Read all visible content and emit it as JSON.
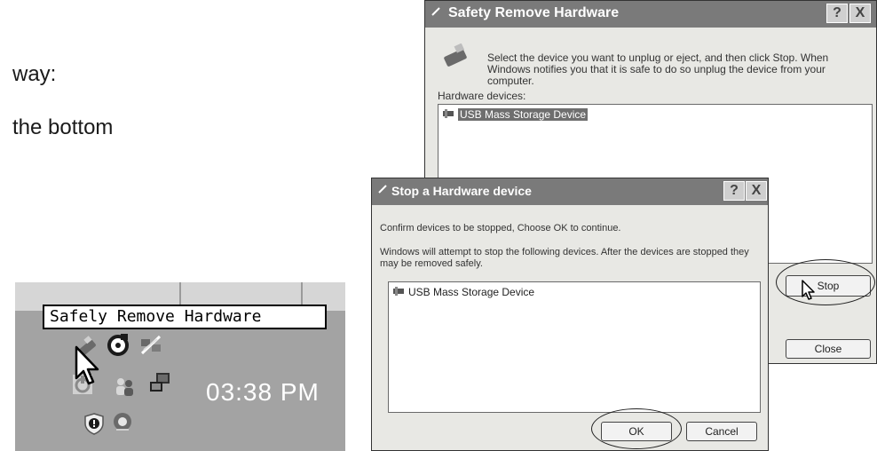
{
  "doc": {
    "line1": "way:",
    "line2": "the bottom"
  },
  "tray": {
    "tooltip": "Safely Remove Hardware",
    "clock": "03:38 PM",
    "icons": [
      "safely-remove-hardware-icon",
      "speaker-icon",
      "network-icon",
      "power-icon",
      "users-icon",
      "computer-icon",
      "security-shield-icon",
      "audio-icon"
    ]
  },
  "dialog_safely": {
    "title": "Safety Remove Hardware",
    "help_button": "?",
    "close_button": "X",
    "instruction": "Select the device you want to unplug or eject, and then click Stop. When Windows notifies you that it is safe to do so unplug the device from your computer.",
    "devices_label": "Hardware devices:",
    "devices": [
      "USB Mass Storage Device"
    ],
    "stop_button": "Stop",
    "close_dialog_button": "Close"
  },
  "dialog_stop": {
    "title": "Stop a Hardware device",
    "help_button": "?",
    "close_button": "X",
    "confirm_text": "Confirm devices to be stopped, Choose OK to continue.",
    "warning_text": "Windows will attempt to stop the following devices. After the devices are stopped they may be removed safely.",
    "devices": [
      "USB Mass Storage Device"
    ],
    "ok_button": "OK",
    "cancel_button": "Cancel"
  },
  "colors": {
    "titlebar": "#7a7a7a",
    "dialog_bg": "#e8e8e4",
    "tray_bg": "#a3a3a3",
    "selection": "#6e6e6e"
  }
}
